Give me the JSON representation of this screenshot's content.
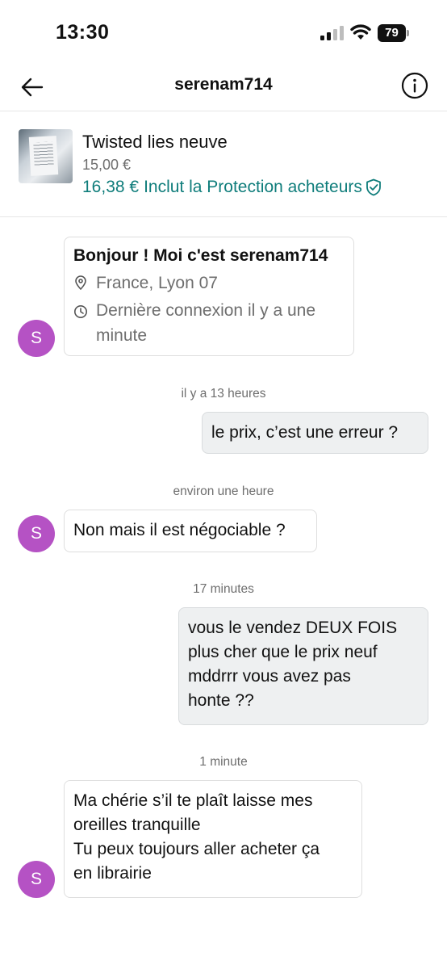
{
  "status_bar": {
    "time": "13:30",
    "battery": "79",
    "icons": [
      "signal-icon",
      "wifi-icon",
      "battery-icon"
    ]
  },
  "header": {
    "title": "serenam714",
    "back_icon": "arrow-left-icon",
    "info_icon": "info-icon"
  },
  "item": {
    "title": "Twisted lies neuve",
    "price": "15,00 €",
    "total_price": "16,38 €",
    "protection_label": "Inclut la Protection acheteurs",
    "protection_icon": "shield-check-icon"
  },
  "profile_card": {
    "greeting": "Bonjour ! Moi c'est serenam714",
    "location": "France, Lyon 07",
    "last_seen_lines": [
      "Dernière connexion il y a une",
      "minute"
    ]
  },
  "avatar_letter": "S",
  "messages": [
    {
      "timestamp": "il y a 13 heures",
      "side": "out",
      "lines": [
        "le prix, c’est une erreur ?"
      ]
    },
    {
      "timestamp": "environ une heure",
      "side": "in",
      "lines": [
        "Non mais il est négociable ?"
      ]
    },
    {
      "timestamp": "17 minutes",
      "side": "out",
      "lines": [
        "vous le vendez DEUX FOIS",
        "plus cher que le prix neuf",
        "mddrrr vous avez pas",
        "honte ??"
      ]
    },
    {
      "timestamp": "1 minute",
      "side": "in",
      "lines": [
        "Ma chérie s’il te plaît laisse mes",
        "oreilles tranquille",
        "Tu peux toujours aller acheter ça",
        "en librairie"
      ]
    }
  ],
  "colors": {
    "accent_teal": "#0f7d7b",
    "avatar_purple": "#b552c4",
    "outgoing_bubble": "#eef0f1"
  }
}
